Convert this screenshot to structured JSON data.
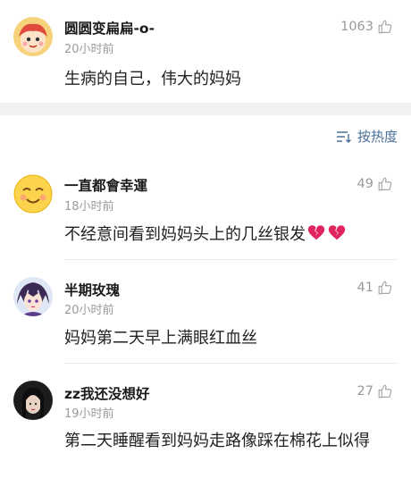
{
  "comments": [
    {
      "username": "圆圆变扁扁-o-",
      "time": "20小时前",
      "likes": "1063",
      "text": "生病的自己，伟大的妈妈",
      "avatar": "cartoon-avatar"
    },
    {
      "username": "一直都會幸運",
      "time": "18小时前",
      "likes": "49",
      "text": "不经意间看到妈妈头上的几丝银发",
      "emoji": "broken-heart-icon x2",
      "avatar": "smiley-avatar"
    },
    {
      "username": "半期玫瑰",
      "time": "20小时前",
      "likes": "41",
      "text": "妈妈第二天早上满眼红血丝",
      "avatar": "anime-avatar"
    },
    {
      "username": "zz我还没想好",
      "time": "19小时前",
      "likes": "27",
      "text": "第二天睡醒看到妈妈走路像踩在棉花上似得",
      "avatar": "photo-avatar"
    }
  ],
  "sort": {
    "label": "按热度",
    "icon": "sort-icon"
  },
  "colors": {
    "accent": "#4a6e98",
    "muted": "#9a9a9a",
    "band": "#f2f2f2"
  }
}
